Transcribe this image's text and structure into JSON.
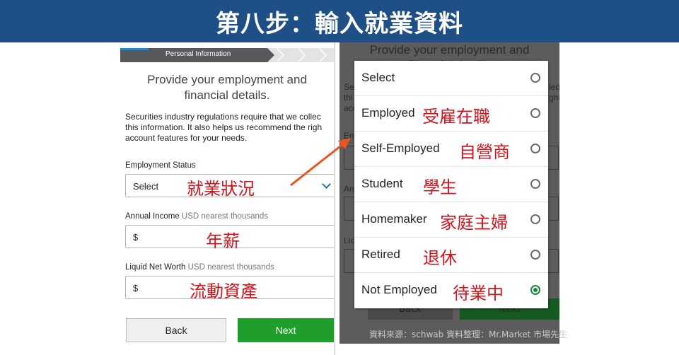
{
  "banner": {
    "title": "第八步：輸入就業資料"
  },
  "left_screen": {
    "progress_label": "Personal Information",
    "heading_line1": "Provide your employment and",
    "heading_line2": "financial details.",
    "paragraph_line1": "Securities industry regulations require that we collec",
    "paragraph_line2": "this information. It also helps us recommend the righ",
    "paragraph_line3": "account features for your needs.",
    "employment": {
      "label": "Employment Status",
      "value": "Select",
      "annotation": "就業狀況"
    },
    "income": {
      "label": "Annual Income",
      "hint": "USD nearest thousands",
      "value": "$",
      "annotation": "年薪"
    },
    "networth": {
      "label": "Liquid Net Worth",
      "hint": "USD nearest thousands",
      "value": "$",
      "annotation": "流動資產"
    },
    "back_label": "Back",
    "next_label": "Next"
  },
  "right_screen": {
    "bg_heading_line1": "Provide your employment and",
    "bg_heading_line2": "financial details",
    "bg_frag_1": "Se",
    "bg_frag_2": "thi",
    "bg_frag_3": "acc",
    "bg_frag_4": "Em",
    "bg_frag_5": "An",
    "bg_frag_6": "Lic",
    "bg_frag_7": "led",
    "bg_frag_8": "ght",
    "bg_back": "Back",
    "bg_next": "Next",
    "options": [
      {
        "label": "Select",
        "annotation": "",
        "selected": false
      },
      {
        "label": "Employed",
        "annotation": "受雇在職",
        "selected": false
      },
      {
        "label": "Self-Employed",
        "annotation": "自營商",
        "selected": false
      },
      {
        "label": "Student",
        "annotation": "學生",
        "selected": false
      },
      {
        "label": "Homemaker",
        "annotation": "家庭主婦",
        "selected": false
      },
      {
        "label": "Retired",
        "annotation": "退休",
        "selected": false
      },
      {
        "label": "Not Employed",
        "annotation": "待業中",
        "selected": true
      }
    ]
  },
  "source_note": "資料來源：schwab  資料整理：Mr.Market 市場先生",
  "colors": {
    "banner": "#1e4f86",
    "annotation_red": "#d2141c",
    "next_green": "#1f9e2c",
    "arrow_orange": "#e8561c",
    "radio_selected": "#168a3a"
  }
}
